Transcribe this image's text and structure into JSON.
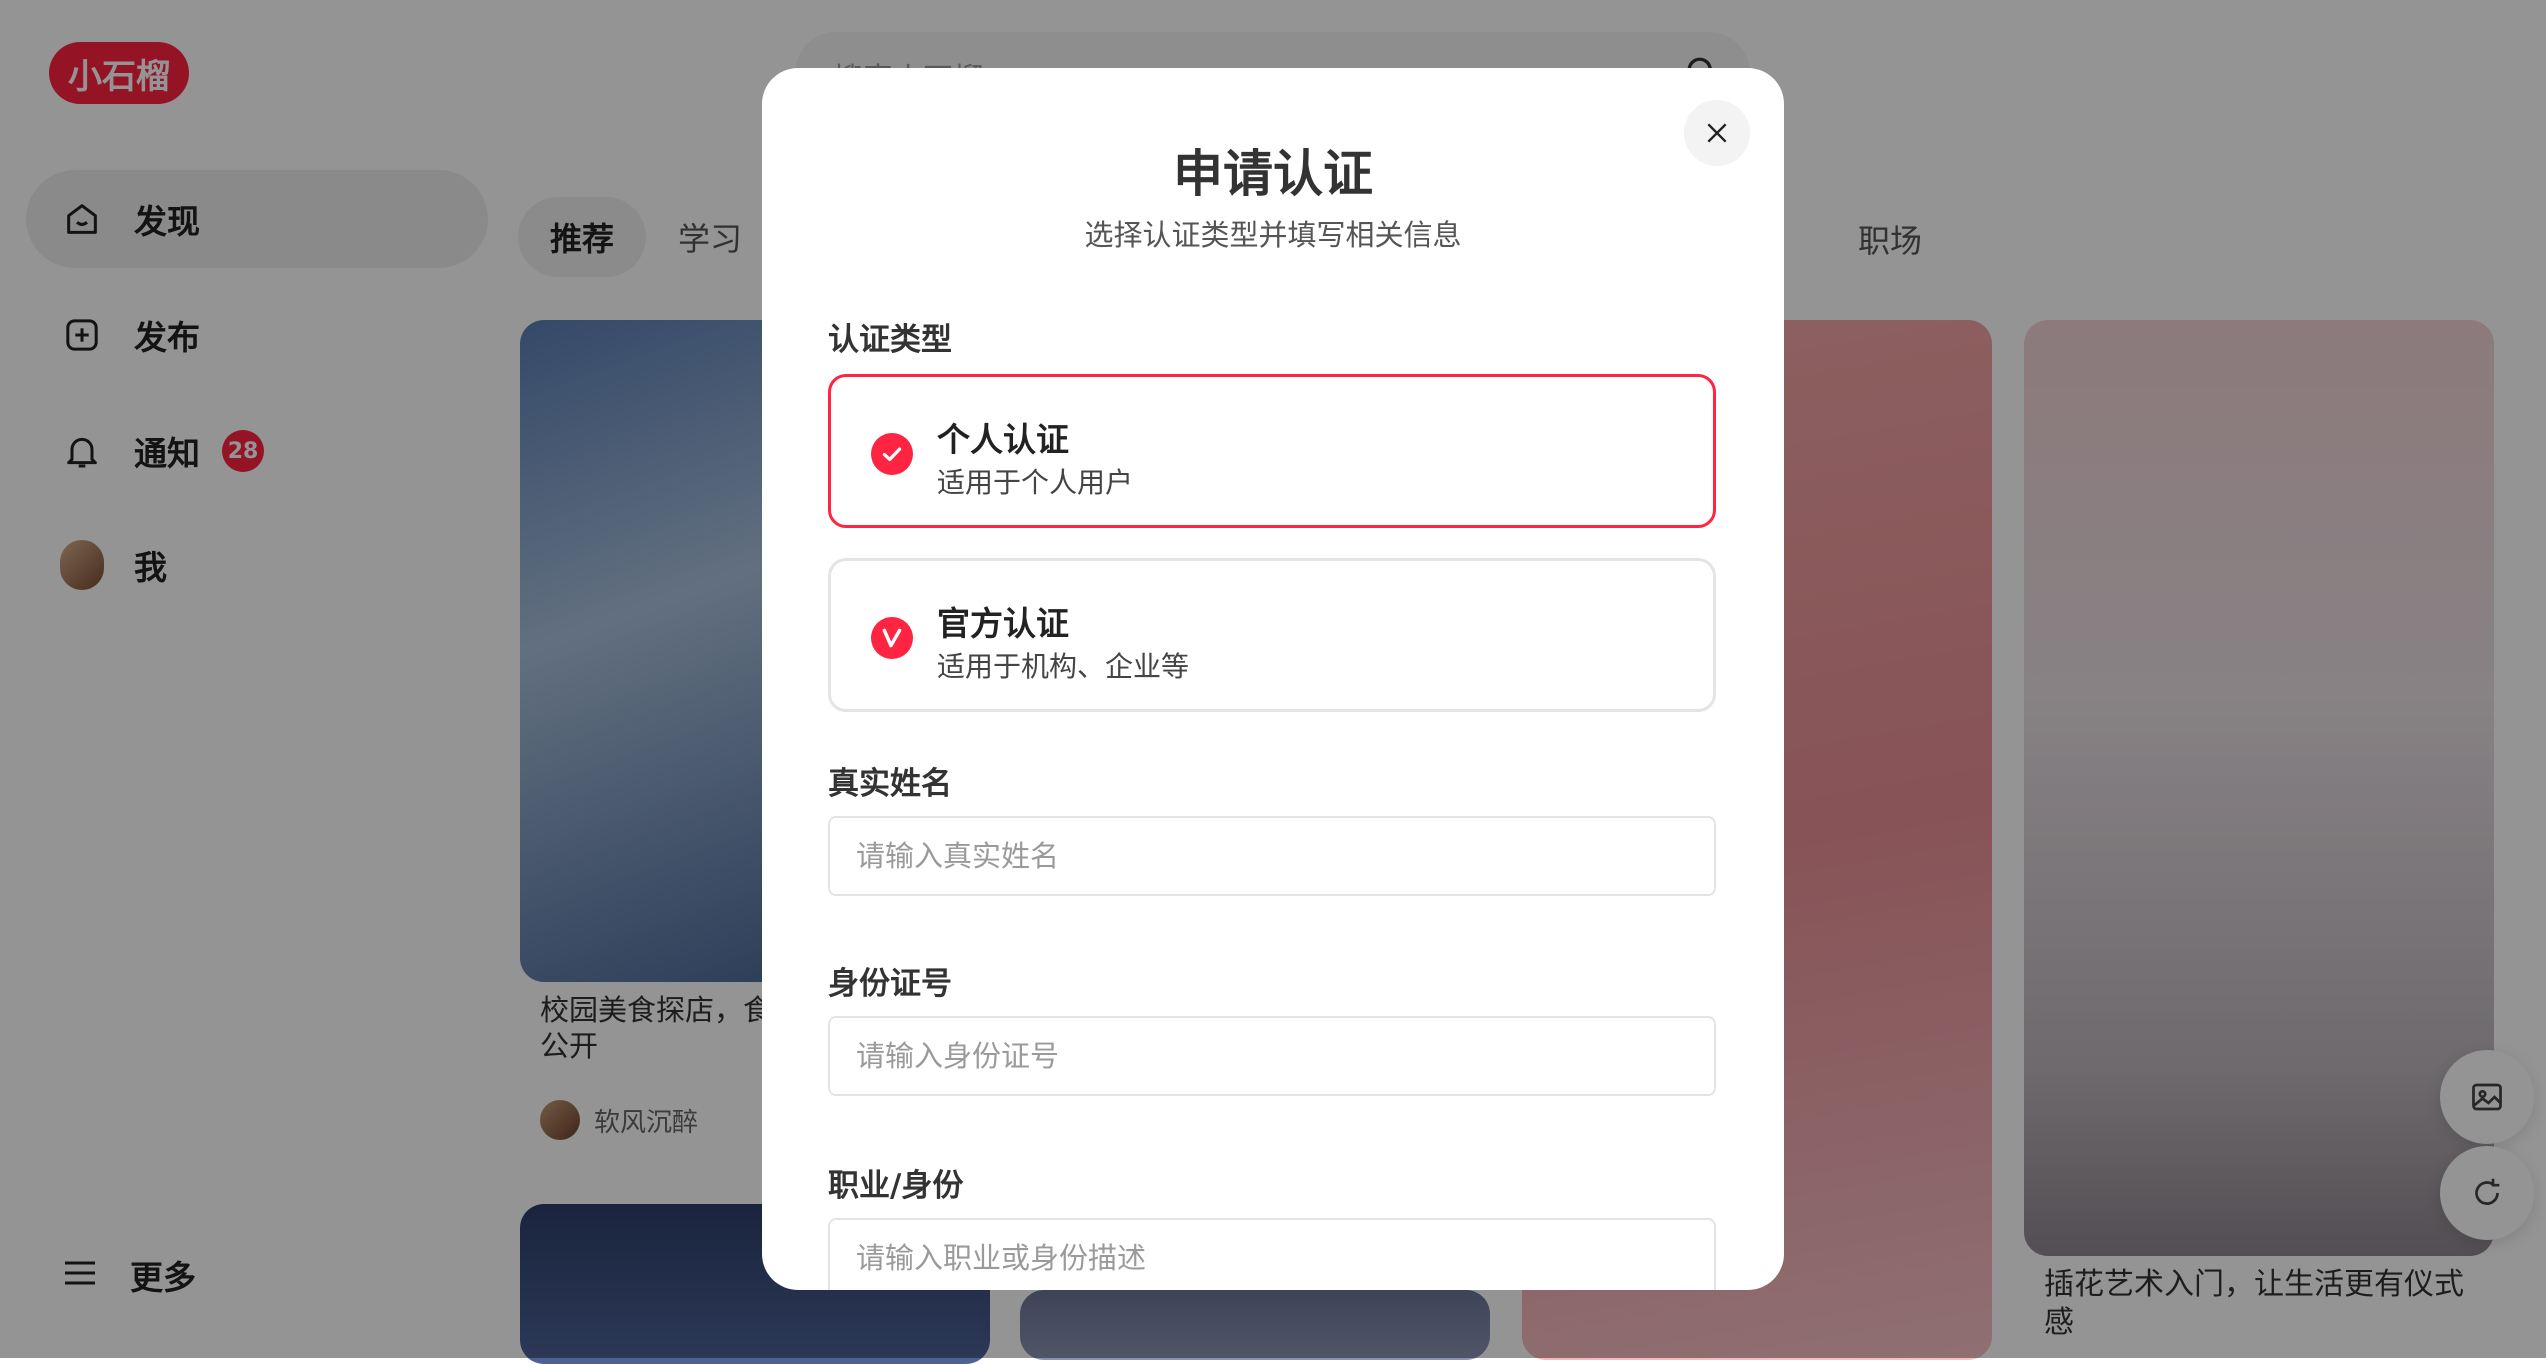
{
  "app": {
    "logo_text": "小石榴",
    "search": {
      "placeholder": "搜索小石榴"
    },
    "sidebar": [
      {
        "label": "发现",
        "icon": "home-icon",
        "active": true
      },
      {
        "label": "发布",
        "icon": "plus-square-icon"
      },
      {
        "label": "通知",
        "icon": "bell-icon",
        "badge": "28"
      },
      {
        "label": "我",
        "icon": "avatar"
      }
    ],
    "more_label": "更多",
    "tabs": [
      "推荐",
      "学习"
    ],
    "tab_right": "职场",
    "feed": {
      "card1_caption": "校园美食探店，食\n公开",
      "card1_author": "软风沉醉",
      "card4_caption": "插花艺术入门，让生活更有仪式\n感"
    }
  },
  "modal": {
    "title": "申请认证",
    "subtitle": "选择认证类型并填写相关信息",
    "type_label": "认证类型",
    "options": [
      {
        "title": "个人认证",
        "desc": "适用于个人用户",
        "selected": true,
        "icon": "check-circle-icon"
      },
      {
        "title": "官方认证",
        "desc": "适用于机构、企业等",
        "selected": false,
        "icon": "v-badge-icon"
      }
    ],
    "fields": [
      {
        "label": "真实姓名",
        "placeholder": "请输入真实姓名",
        "value": ""
      },
      {
        "label": "身份证号",
        "placeholder": "请输入身份证号",
        "value": ""
      },
      {
        "label": "职业/身份",
        "placeholder": "请输入职业或身份描述",
        "value": ""
      }
    ]
  },
  "colors": {
    "accent": "#ff2442",
    "overlay": "rgba(0,0,0,0.42)"
  }
}
